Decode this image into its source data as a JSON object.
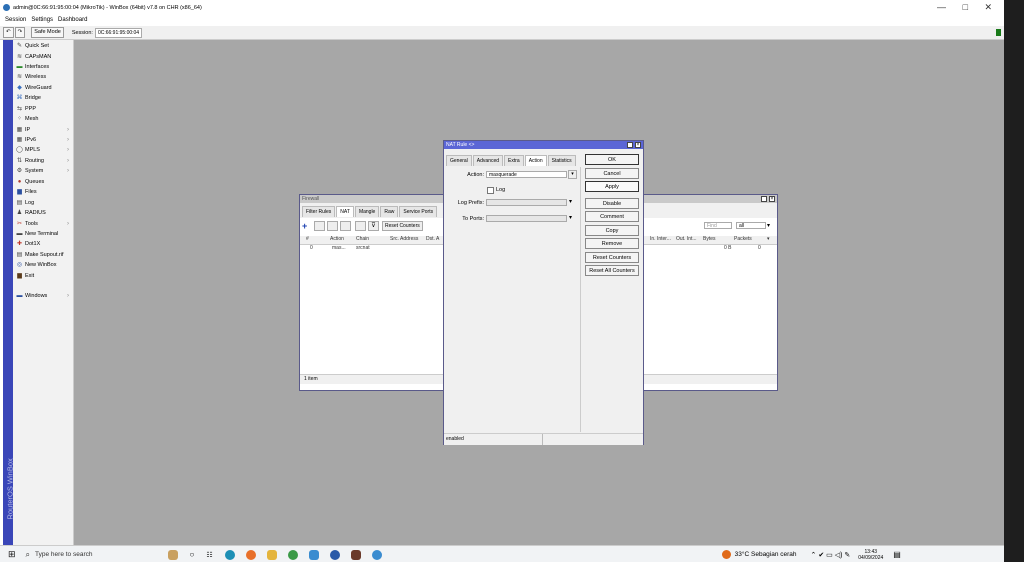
{
  "window": {
    "title": "admin@0C:66:91:95:00:04 (MikroTik) - WinBox (64bit) v7.8 on CHR (x86_64)",
    "minimize": "—",
    "maximize": "□",
    "close": "✕"
  },
  "menubar": [
    "Session",
    "Settings",
    "Dashboard"
  ],
  "toolbar": {
    "undo": "↶",
    "redo": "↷",
    "safe_mode": "Safe Mode",
    "session_label": "Session:",
    "session_value": "0C:66:91:95:00:04"
  },
  "sidebar_brand": "RouterOS WinBox",
  "menu": [
    {
      "label": "Quick Set",
      "icon": "✎",
      "arrow": ""
    },
    {
      "label": "CAPsMAN",
      "icon": "≋",
      "arrow": ""
    },
    {
      "label": "Interfaces",
      "icon": "▬",
      "arrow": ""
    },
    {
      "label": "Wireless",
      "icon": "≋",
      "arrow": ""
    },
    {
      "label": "WireGuard",
      "icon": "◆",
      "arrow": ""
    },
    {
      "label": "Bridge",
      "icon": "⌘",
      "arrow": ""
    },
    {
      "label": "PPP",
      "icon": "⇆",
      "arrow": ""
    },
    {
      "label": "Mesh",
      "icon": "⁘",
      "arrow": ""
    },
    {
      "label": "IP",
      "icon": "▦",
      "arrow": "›"
    },
    {
      "label": "IPv6",
      "icon": "▦",
      "arrow": "›"
    },
    {
      "label": "MPLS",
      "icon": "◯",
      "arrow": "›"
    },
    {
      "label": "Routing",
      "icon": "⇅",
      "arrow": "›"
    },
    {
      "label": "System",
      "icon": "⚙",
      "arrow": "›"
    },
    {
      "label": "Queues",
      "icon": "●",
      "arrow": ""
    },
    {
      "label": "Files",
      "icon": "▆",
      "arrow": ""
    },
    {
      "label": "Log",
      "icon": "▤",
      "arrow": ""
    },
    {
      "label": "RADIUS",
      "icon": "♟",
      "arrow": ""
    },
    {
      "label": "Tools",
      "icon": "✂",
      "arrow": "›"
    },
    {
      "label": "New Terminal",
      "icon": "▬",
      "arrow": ""
    },
    {
      "label": "Dot1X",
      "icon": "✚",
      "arrow": ""
    },
    {
      "label": "Make Supout.rif",
      "icon": "▤",
      "arrow": ""
    },
    {
      "label": "New WinBox",
      "icon": "◎",
      "arrow": ""
    },
    {
      "label": "Exit",
      "icon": "▆",
      "arrow": ""
    },
    {
      "label": "Windows",
      "icon": "▬",
      "arrow": "›"
    }
  ],
  "firewall": {
    "title": "Firewall",
    "tabs": [
      "Filter Rules",
      "NAT",
      "Mangle",
      "Raw",
      "Service Ports"
    ],
    "reset_counters": "Reset Counters",
    "find_placeholder": "Find",
    "filter_value": "all",
    "columns_left": [
      "#",
      "Action",
      "Chain",
      "Src. Address",
      "Dst. A"
    ],
    "columns_right": [
      "In. Inter...",
      "Out. Int...",
      "Bytes",
      "Packets"
    ],
    "row": {
      "num": "0",
      "action": "mas...",
      "chain": "srcnat",
      "bytes": "0 B",
      "packets": "0"
    },
    "status": "1 item"
  },
  "nat_rule": {
    "title": "NAT Rule <>",
    "tabs": [
      "General",
      "Advanced",
      "Extra",
      "Action",
      "Statistics"
    ],
    "action_label": "Action:",
    "action_value": "masquerade",
    "log_label": "Log",
    "log_prefix_label": "Log Prefix:",
    "to_ports_label": "To Ports:",
    "buttons": [
      "OK",
      "Cancel",
      "Apply",
      "Disable",
      "Comment",
      "Copy",
      "Remove",
      "Reset Counters",
      "Reset All Counters"
    ],
    "status": "enabled"
  },
  "taskbar": {
    "search_placeholder": "Type here to search",
    "weather": "33°C  Sebagian cerah",
    "time": "13:43",
    "date": "04/09/2024"
  }
}
